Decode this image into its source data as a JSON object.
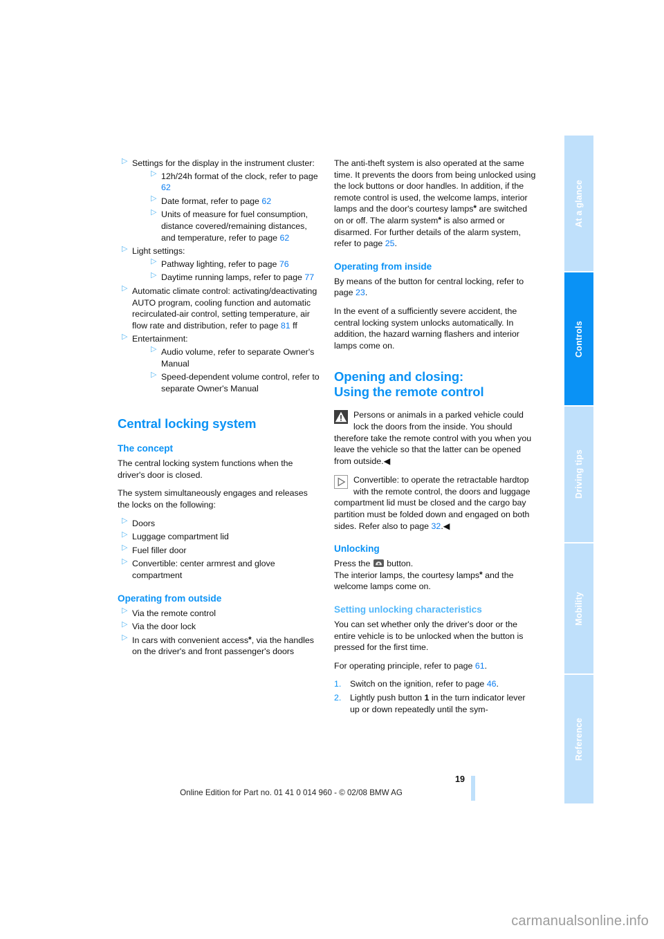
{
  "document": {
    "page_number": "19",
    "imprint": "Online Edition for Part no. 01 41 0 014 960 - © 02/08 BMW AG",
    "watermark": "carmanualsonline.info"
  },
  "colors": {
    "accent": "#0a92f5",
    "accent_pale": "#52b7fb",
    "tab_inactive": "#bfe0fb",
    "page_link": "#0a7cf0",
    "bullet": "#55b5f2"
  },
  "sidebar": {
    "tabs": [
      {
        "label": "At a glance",
        "active": false
      },
      {
        "label": "Controls",
        "active": true
      },
      {
        "label": "Driving tips",
        "active": false
      },
      {
        "label": "Mobility",
        "active": false
      },
      {
        "label": "Reference",
        "active": false
      }
    ]
  },
  "left_column": {
    "bullets": [
      {
        "text": "Settings for the display in the instrument cluster:",
        "sub": [
          {
            "pre": "12h/24h format of the clock, refer to page ",
            "link": "62",
            "post": ""
          },
          {
            "pre": "Date format, refer to page ",
            "link": "62",
            "post": ""
          },
          {
            "pre": "Units of measure for fuel consumption, distance covered/remaining distances, and temperature, refer to page ",
            "link": "62",
            "post": ""
          }
        ]
      },
      {
        "text": "Light settings:",
        "sub": [
          {
            "pre": "Pathway lighting, refer to page ",
            "link": "76",
            "post": ""
          },
          {
            "pre": "Daytime running lamps, refer to page ",
            "link": "77",
            "post": ""
          }
        ]
      },
      {
        "pre": "Automatic climate control: activating/deactivating AUTO program, cooling function and automatic recirculated-air control, setting temperature, air flow rate and distribution, refer to page ",
        "link": "81",
        "post": " ff",
        "sub": []
      },
      {
        "text": "Entertainment:",
        "sub": [
          {
            "pre": "Audio volume, refer to separate Owner's Manual",
            "link": "",
            "post": ""
          },
          {
            "pre": "Speed-dependent volume control, refer to separate Owner's Manual",
            "link": "",
            "post": ""
          }
        ]
      }
    ],
    "section_title": "Central locking system",
    "concept_heading": "The concept",
    "concept_p1": "The central locking system functions when the driver's door is closed.",
    "concept_p2": "The system simultaneously engages and releases the locks on the following:",
    "concept_list": [
      "Doors",
      "Luggage compartment lid",
      "Fuel filler door",
      "Convertible: center armrest and glove compartment"
    ],
    "outside_heading": "Operating from outside",
    "outside_list": [
      {
        "pre": "Via the remote control",
        "asterisk": false,
        "post": ""
      },
      {
        "pre": "Via the door lock",
        "asterisk": false,
        "post": ""
      },
      {
        "pre": "In cars with convenient access",
        "asterisk": true,
        "post": ", via the handles on the driver's and front passenger's doors"
      }
    ]
  },
  "right_column": {
    "antitheft": {
      "seg1": "The anti-theft system is also operated at the same time. It prevents the doors from being unlocked using the lock buttons or door handles. In addition, if the remote control is used, the welcome lamps, interior lamps and the door's courtesy lamps",
      "seg2": " are switched on or off. The alarm system",
      "seg3": " is also armed or disarmed. For further details of the alarm system, refer to page ",
      "link": "25",
      "seg4": "."
    },
    "inside_heading": "Operating from inside",
    "inside_p1_pre": "By means of the button for central locking, refer to page ",
    "inside_p1_link": "23",
    "inside_p1_post": ".",
    "inside_p2": "In the event of a sufficiently severe accident, the central locking system unlocks automatically. In addition, the hazard warning flashers and interior lamps come on.",
    "section_title_line1": "Opening and closing:",
    "section_title_line2": "Using the remote control",
    "warning_note": "Persons or animals in a parked vehicle could lock the doors from the inside. You should therefore take the remote control with you when you leave the vehicle so that the latter can be opened from outside.",
    "warning_endmark": "◀",
    "tip_note_pre": "Convertible: to operate the retractable hardtop with the remote control, the doors and luggage compartment lid must be closed and the cargo bay partition must be folded down and engaged on both sides. Refer also to page ",
    "tip_note_link": "32",
    "tip_note_post": ".",
    "tip_endmark": "◀",
    "unlocking_heading": "Unlocking",
    "unlocking_p1_pre": "Press the ",
    "unlocking_p1_post": " button.",
    "unlocking_p2_pre": "The interior lamps, the courtesy lamps",
    "unlocking_p2_post": " and the welcome lamps come on.",
    "setting_heading": "Setting unlocking characteristics",
    "setting_p1": "You can set whether only the driver's door or the entire vehicle is to be unlocked when the button is pressed for the first time.",
    "setting_p2_pre": "For operating principle, refer to page ",
    "setting_p2_link": "61",
    "setting_p2_post": ".",
    "steps": [
      {
        "num": "1.",
        "pre": "Switch on the ignition, refer to page ",
        "link": "46",
        "post": ".",
        "bold": "",
        "tail": ""
      },
      {
        "num": "2.",
        "pre": "Lightly push button ",
        "link": "",
        "post": "",
        "bold": "1",
        "tail": " in the turn indicator lever up or down repeatedly until the sym-"
      }
    ]
  },
  "icons": {
    "warning": "warning-triangle-icon",
    "tip": "note-triangle-icon",
    "unlock_button": "remote-unlock-button-icon"
  }
}
